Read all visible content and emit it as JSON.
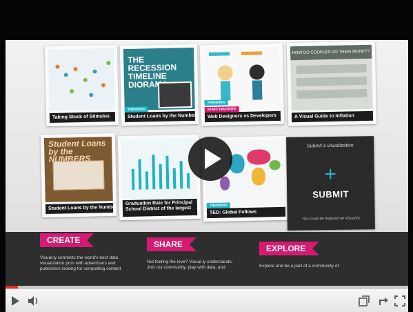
{
  "tiles": [
    {
      "caption": "Taking Stock of Stimulus"
    },
    {
      "caption": "Student Loans by the Numbers",
      "badge": "TRENDING",
      "art_title": "THE RECESSION TIMELINE DIORAMA"
    },
    {
      "caption": "Web Designers vs Developers",
      "badge": "STAFF FAVORITE",
      "badge2": "TRENDING"
    },
    {
      "caption": "A Visual Guide to Inflation",
      "art_title": "HOW DO COUPLES DO THEIR MONEY?"
    },
    {
      "caption": "Student Loans by the Numbers",
      "art_title": "Student Loans by the NUMBERS"
    },
    {
      "caption": "Graduation Rate for Principal School District of the largest"
    },
    {
      "caption": "TED: Global Follows",
      "badge": "TRENDING"
    }
  ],
  "submit": {
    "hint": "Submit a visualization",
    "plus": "+",
    "label": "SUBMIT",
    "footer": "You could be featured on Visual.ly!"
  },
  "sections": [
    {
      "title": "CREATE",
      "text": "Visual.ly connects the world's best data visualization pros with advertisers and publishers looking for compelling content"
    },
    {
      "title": "SHARE",
      "text": "Not feeling the love? Visual.ly understands. Join our community, play with data, and"
    },
    {
      "title": "EXPLORE",
      "text": "Explore and be a part of a community of"
    }
  ],
  "player": {
    "progress_fraction": 0.03,
    "progress_color": "#e52d27",
    "icons": [
      "play-icon",
      "volume-icon",
      "popout-icon",
      "share-icon",
      "fullscreen-icon"
    ]
  }
}
